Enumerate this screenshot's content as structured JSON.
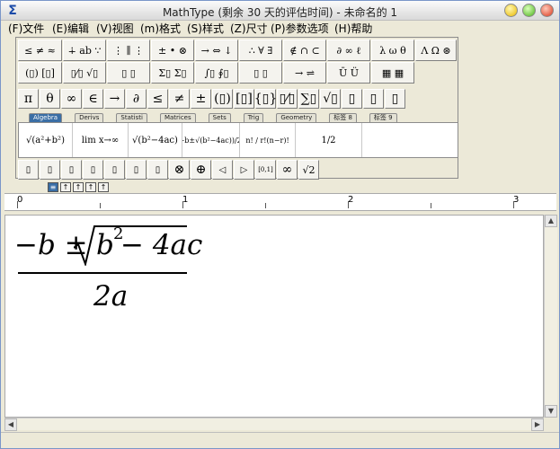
{
  "window": {
    "title": "MathType (剩余 30 天的评估时间) - 未命名的 1"
  },
  "menu": [
    "(F)文件",
    "(E)编辑",
    "(V)视图",
    "(m)格式",
    "(S)样式",
    "(Z)尺寸",
    "(P)参数选项",
    "(H)帮助"
  ],
  "palette": {
    "row1": [
      "≤ ≠ ≈",
      "∔ ab ∵",
      "⋮ ∥ ⋮",
      "± • ⊗",
      "→ ⇔ ↓",
      "∴ ∀ ∃",
      "∉ ∩ ⊂",
      "∂ ∞ ℓ",
      "λ ω θ",
      "Λ Ω ⊛"
    ],
    "row2": [
      "(▯) [▯]",
      "▯⁄▯ √▯",
      "▯ ▯",
      "Σ▯ Σ▯",
      "∫▯ ∮▯",
      "▯ ▯",
      "→ ⇌",
      "Ū Ü",
      "▦ ▦"
    ],
    "row3": [
      "π",
      "θ",
      "∞",
      "∈",
      "→",
      "∂",
      "≤",
      "≠",
      "±",
      "(▯)",
      "[▯]",
      "{▯}",
      "▯⁄▯",
      "∑▯",
      "√▯",
      "▯",
      "▯",
      "▯"
    ],
    "tabs": [
      "Algebra",
      "Derivs",
      "Statisti",
      "Matrices",
      "Sets",
      "Trig",
      "Geometry",
      "标签 8",
      "标签 9"
    ],
    "templates": [
      "√(a²+b²)",
      "lim x→∞",
      "√(b²−4ac)",
      "(−b±√(b²−4ac))/2a",
      "n! / r!(n−r)!",
      "1/2"
    ],
    "row_bottom": [
      "▯",
      "▯",
      "▯",
      "▯",
      "▯",
      "▯",
      "▯",
      "⊗",
      "⊕",
      "◁",
      "▷",
      "[0,1]",
      "∞",
      "√2"
    ],
    "levels": [
      "≡",
      "↑",
      "↑",
      "↑",
      "↑"
    ]
  },
  "ruler": {
    "labels": [
      "0",
      "1",
      "2",
      "3"
    ]
  },
  "equation": {
    "numerator_a": "−b ±",
    "radical_content": "b",
    "exponent": "2",
    "numerator_b": " − 4ac",
    "denominator": "2a"
  }
}
